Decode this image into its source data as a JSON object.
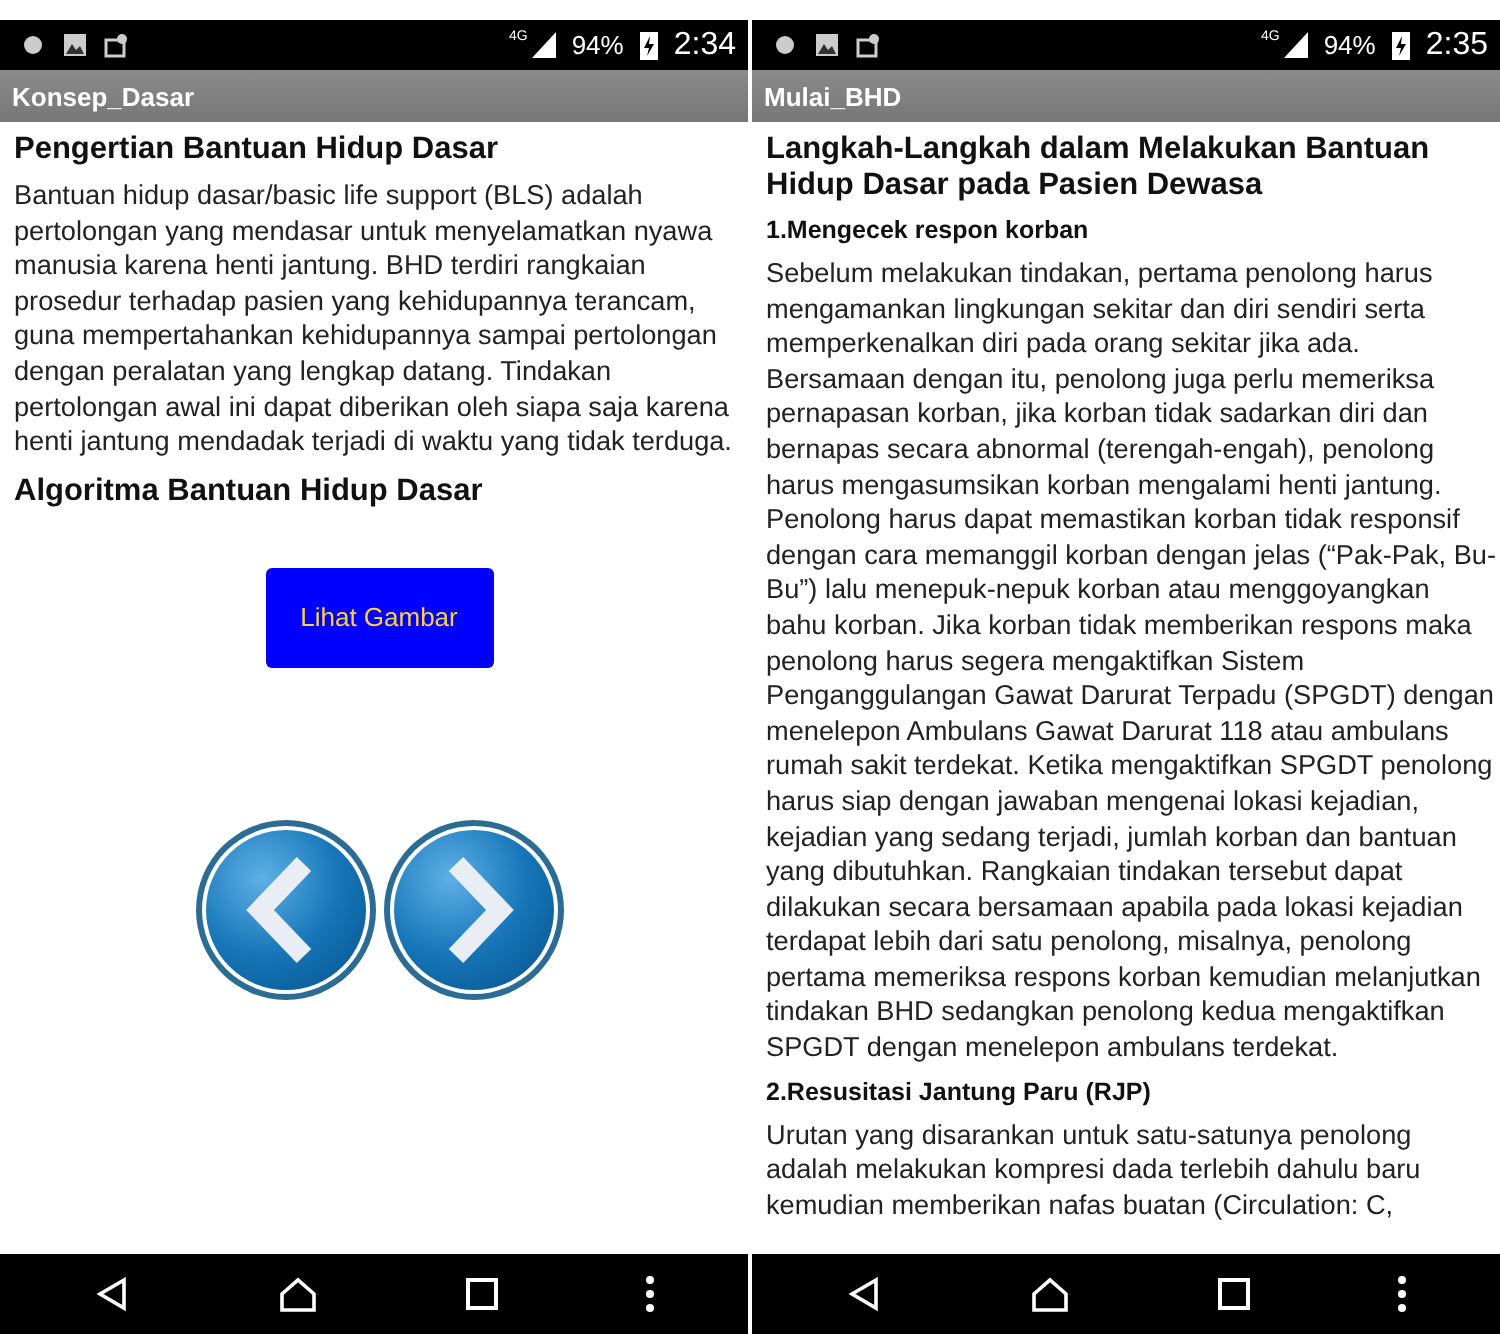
{
  "screens": [
    {
      "status_bar": {
        "network": "4G",
        "battery": "94%",
        "time": "2:34"
      },
      "title": "Konsep_Dasar",
      "blocks": [
        {
          "kind": "heading",
          "text": "Pengertian Bantuan Hidup Dasar"
        },
        {
          "kind": "paragraph",
          "text": "Bantuan hidup dasar/basic life support (BLS) adalah pertolongan yang mendasar untuk menyelamatkan nyawa manusia karena henti jantung. BHD terdiri rangkaian prosedur terhadap pasien yang kehidupannya terancam, guna mempertahankan kehidupannya sampai pertolongan dengan peralatan yang lengkap datang. Tindakan pertolongan awal ini dapat diberikan oleh siapa saja karena henti jantung mendadak terjadi di waktu yang tidak terduga."
        },
        {
          "kind": "heading",
          "text": "Algoritma Bantuan Hidup Dasar"
        },
        {
          "kind": "button",
          "text": "Lihat Gambar"
        },
        {
          "kind": "arrows"
        }
      ]
    },
    {
      "status_bar": {
        "network": "4G",
        "battery": "94%",
        "time": "2:35"
      },
      "title": "Mulai_BHD",
      "blocks": [
        {
          "kind": "heading",
          "text": "Langkah-Langkah dalam Melakukan Bantuan Hidup Dasar pada Pasien Dewasa"
        },
        {
          "kind": "step",
          "text": "1.Mengecek respon korban"
        },
        {
          "kind": "paragraph",
          "text": "Sebelum melakukan tindakan, pertama penolong harus mengamankan lingkungan sekitar dan diri sendiri serta memperkenalkan diri pada orang sekitar jika ada. Bersamaan dengan itu, penolong juga perlu memeriksa pernapasan korban, jika korban tidak sadarkan diri dan bernapas secara abnormal (terengah-engah), penolong harus mengasumsikan korban mengalami henti jantung. Penolong harus dapat memastikan korban tidak responsif dengan cara memanggil korban dengan jelas (“Pak-Pak, Bu-Bu”) lalu menepuk-nepuk korban atau menggoyangkan bahu korban. Jika korban tidak memberikan respons maka penolong harus segera mengaktifkan Sistem Penganggulangan Gawat Darurat Terpadu (SPGDT) dengan menelepon Ambulans Gawat Darurat 118 atau ambulans rumah sakit terdekat. Ketika mengaktifkan SPGDT penolong harus siap dengan jawaban mengenai lokasi kejadian, kejadian yang sedang terjadi, jumlah korban dan bantuan yang dibutuhkan. Rangkaian tindakan tersebut dapat dilakukan secara bersamaan apabila pada lokasi kejadian terdapat lebih dari satu penolong, misalnya, penolong pertama memeriksa respons korban kemudian melanjutkan tindakan BHD sedangkan penolong kedua mengaktifkan SPGDT dengan menelepon ambulans terdekat."
        },
        {
          "kind": "step",
          "text": "2.Resusitasi Jantung Paru (RJP)"
        },
        {
          "kind": "paragraph",
          "text": "Urutan yang disarankan untuk satu-satunya penolong adalah melakukan kompresi dada terlebih dahulu baru kemudian memberikan nafas buatan (Circulation: C,"
        }
      ]
    }
  ]
}
